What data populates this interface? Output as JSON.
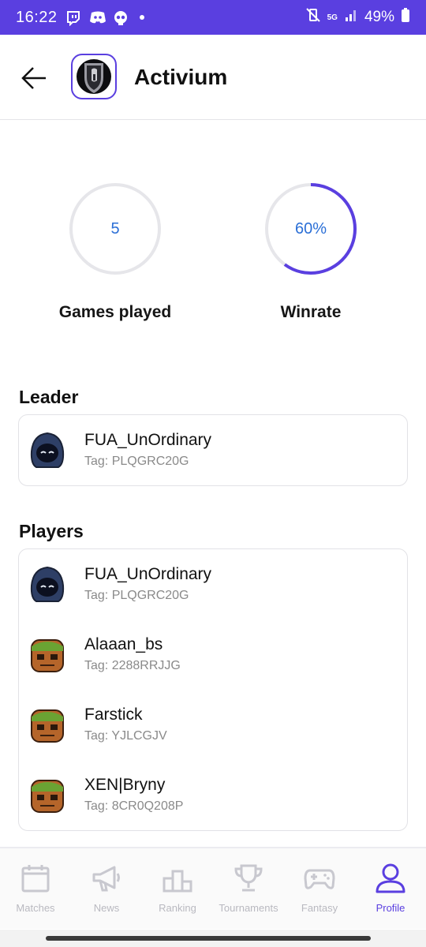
{
  "status_bar": {
    "time": "16:22",
    "battery": "49%",
    "network": "5G",
    "bg_color": "#5a3fe0"
  },
  "header": {
    "team_name": "Activium",
    "back_icon": "arrow-left-icon",
    "logo_icon": "spartan-shield-icon"
  },
  "stats": {
    "games_played": {
      "value": "5",
      "label": "Games played"
    },
    "winrate": {
      "value": "60%",
      "label": "Winrate",
      "fraction": 0.6
    },
    "accent_color": "#5a3fe0"
  },
  "leader": {
    "title": "Leader",
    "player": {
      "name": "FUA_UnOrdinary",
      "tag": "Tag: PLQGRC20G",
      "avatar": "hooded-figure-icon"
    }
  },
  "players": {
    "title": "Players",
    "items": [
      {
        "name": "FUA_UnOrdinary",
        "tag": "Tag: PLQGRC20G",
        "avatar": "hooded-figure-icon"
      },
      {
        "name": "Alaaan_bs",
        "tag": "Tag: 2288RRJJG",
        "avatar": "groot-head-icon"
      },
      {
        "name": "Farstick",
        "tag": "Tag: YJLCGJV",
        "avatar": "groot-head-icon"
      },
      {
        "name": "XEN|Bryny",
        "tag": "Tag: 8CR0Q208P",
        "avatar": "groot-head-icon"
      }
    ]
  },
  "bottom_nav": {
    "items": [
      {
        "label": "Matches",
        "icon": "calendar-icon"
      },
      {
        "label": "News",
        "icon": "megaphone-icon"
      },
      {
        "label": "Ranking",
        "icon": "podium-icon"
      },
      {
        "label": "Tournaments",
        "icon": "trophy-icon"
      },
      {
        "label": "Fantasy",
        "icon": "gamepad-icon"
      },
      {
        "label": "Profile",
        "icon": "user-icon",
        "active": true
      }
    ]
  }
}
